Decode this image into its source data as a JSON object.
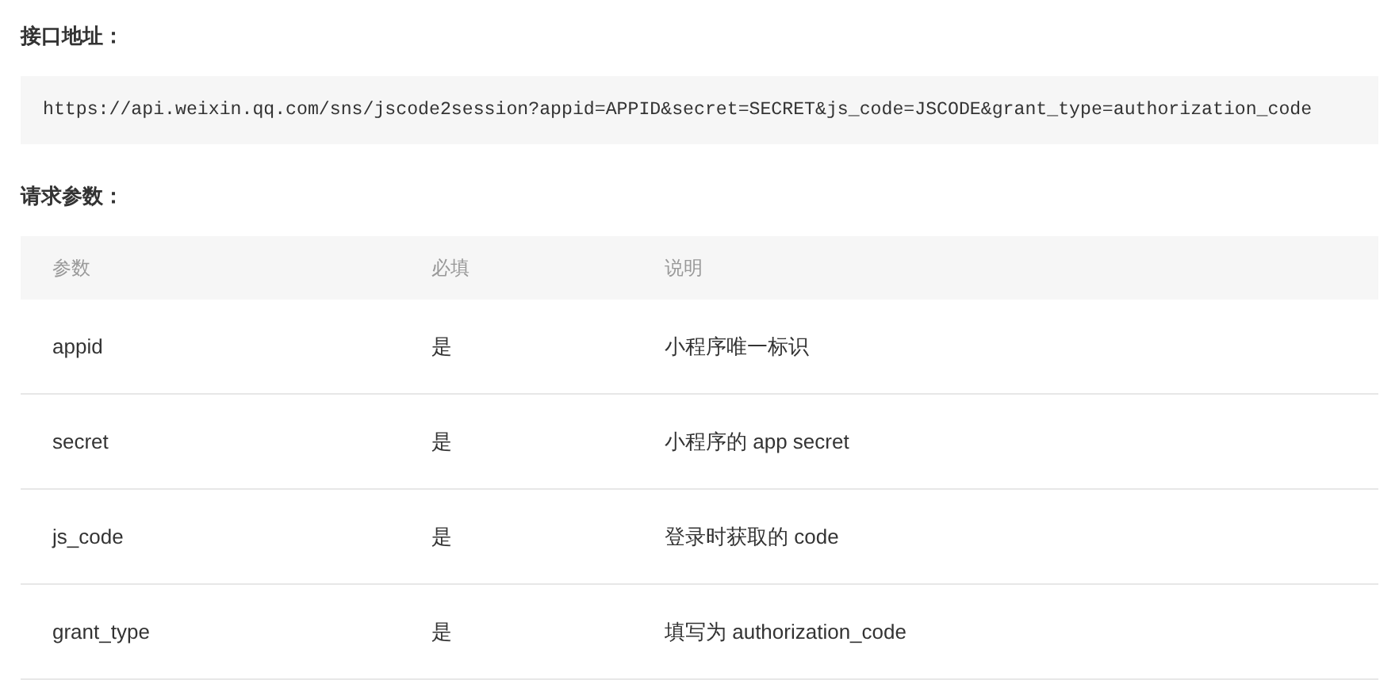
{
  "sections": [
    {
      "heading": "接口地址：",
      "code": "https://api.weixin.qq.com/sns/jscode2session?appid=APPID&secret=SECRET&js_code=JSCODE&grant_type=authorization_code"
    },
    {
      "heading": "请求参数：",
      "table": {
        "columns": [
          "参数",
          "必填",
          "说明"
        ],
        "rows": [
          [
            "appid",
            "是",
            "小程序唯一标识"
          ],
          [
            "secret",
            "是",
            "小程序的 app secret"
          ],
          [
            "js_code",
            "是",
            "登录时获取的 code"
          ],
          [
            "grant_type",
            "是",
            "填写为 authorization_code"
          ]
        ]
      }
    }
  ]
}
